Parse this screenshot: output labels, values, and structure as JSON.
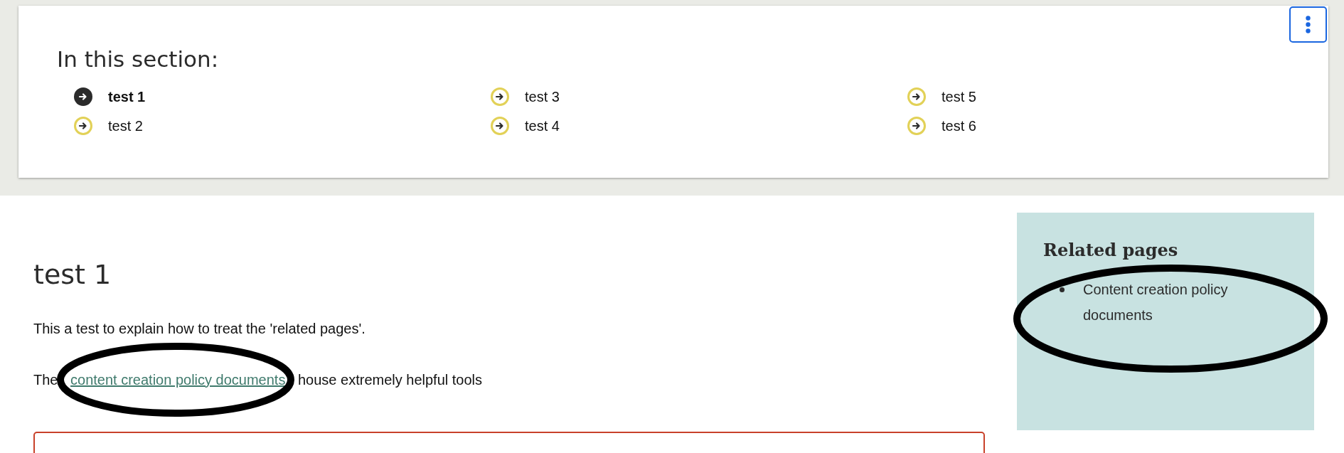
{
  "section": {
    "title": "In this section:",
    "items": [
      {
        "label": "test 1",
        "selected": true
      },
      {
        "label": "test 2",
        "selected": false
      },
      {
        "label": "test 3",
        "selected": false
      },
      {
        "label": "test 4",
        "selected": false
      },
      {
        "label": "test 5",
        "selected": false
      },
      {
        "label": "test 6",
        "selected": false
      }
    ]
  },
  "main": {
    "heading": "test 1",
    "intro": "This a test to explain how to treat the 'related pages'.",
    "sentence": {
      "before": "The",
      "link": "content creation policy documents",
      "after": "house extremely helpful tools"
    }
  },
  "related": {
    "title": "Related pages",
    "items": [
      "Content creation policy documents"
    ]
  }
}
